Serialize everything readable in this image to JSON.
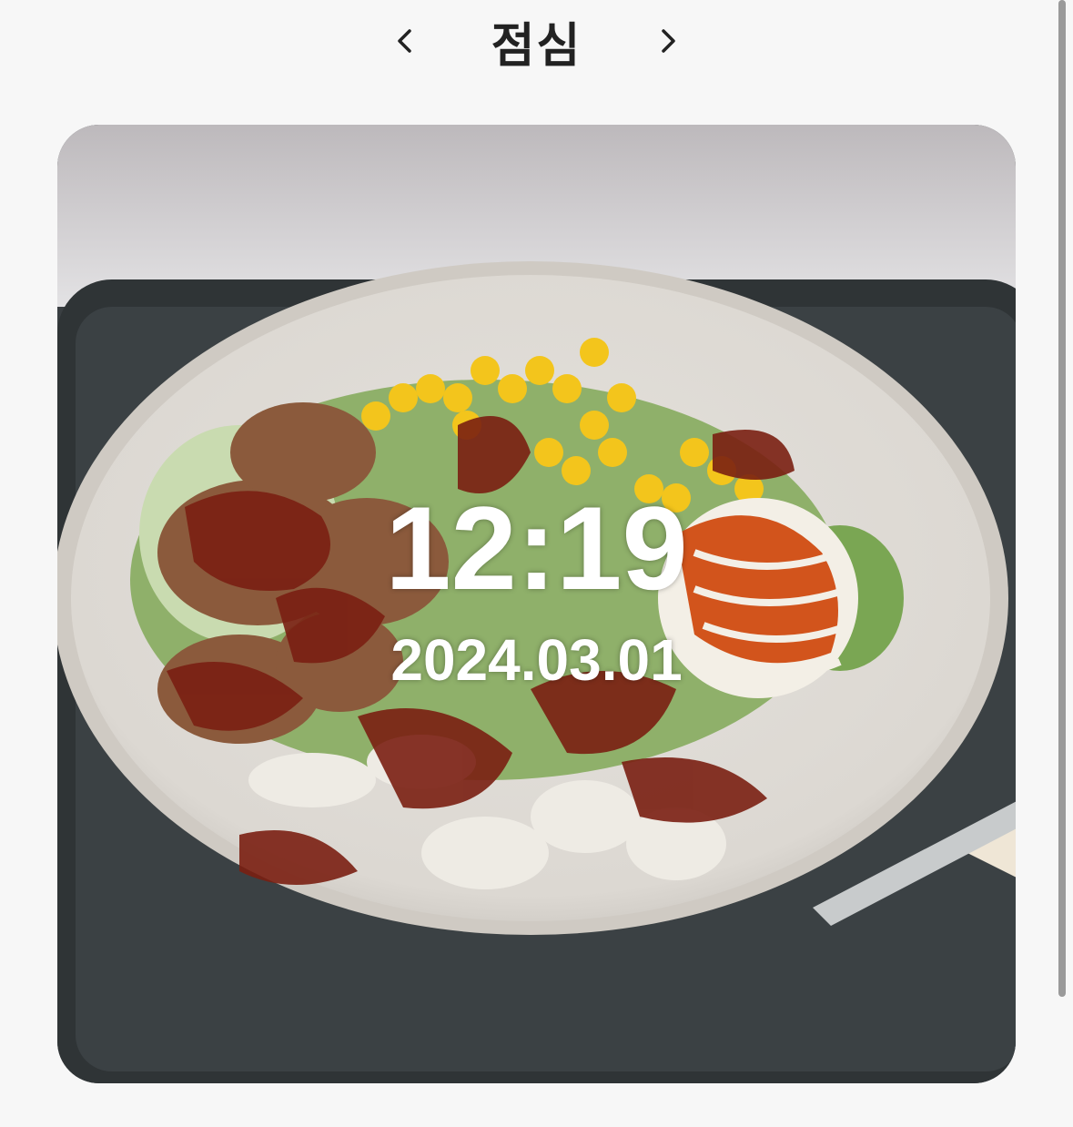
{
  "header": {
    "title": "점심",
    "prev_icon": "chevron-left-icon",
    "next_icon": "chevron-right-icon"
  },
  "photo": {
    "subject": "salad-bowl",
    "time": "12:19",
    "date": "2024.03.01"
  },
  "colors": {
    "background": "#f7f7f7",
    "title": "#222222",
    "overlay_text": "#ffffff"
  }
}
